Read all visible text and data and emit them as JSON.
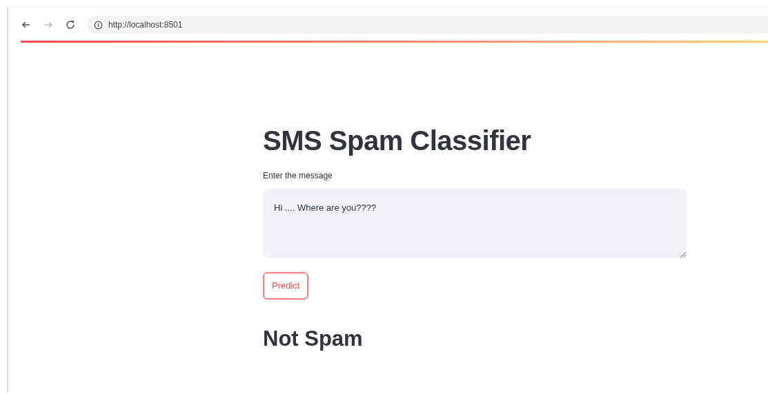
{
  "browser": {
    "url": "http://localhost:8501"
  },
  "app": {
    "title": "SMS Spam Classifier",
    "input_label": "Enter the message",
    "message": "Hi .... Where are you????",
    "button": "Predict",
    "result": "Not Spam"
  }
}
